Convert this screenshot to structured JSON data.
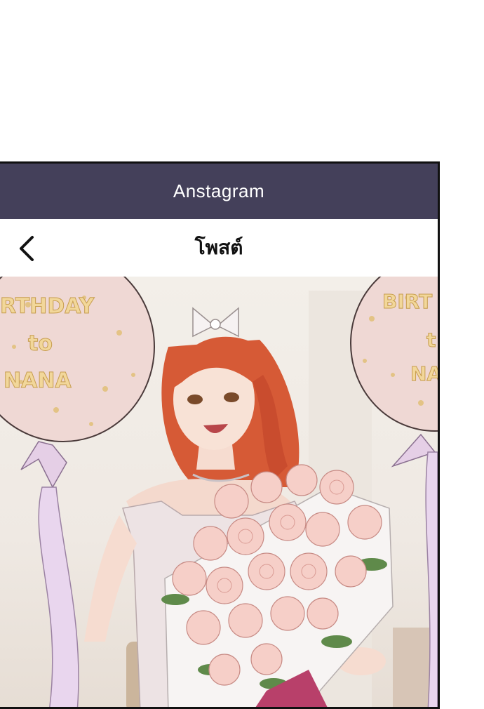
{
  "app_bar": {
    "title": "Anstagram"
  },
  "post_header": {
    "title": "โพสต์",
    "back_icon": "chevron-left-icon"
  },
  "photo": {
    "balloon_left": {
      "line1": "RTHDAY",
      "line2": "to",
      "line3": "NANA"
    },
    "balloon_right": {
      "line1": "BIRT",
      "line2": "t",
      "line3": "NA"
    }
  },
  "colors": {
    "app_bar_bg": "#44405a",
    "app_bar_text": "#ffffff",
    "balloon": "#f1dcd8",
    "text_gold": "#f2d79a"
  }
}
